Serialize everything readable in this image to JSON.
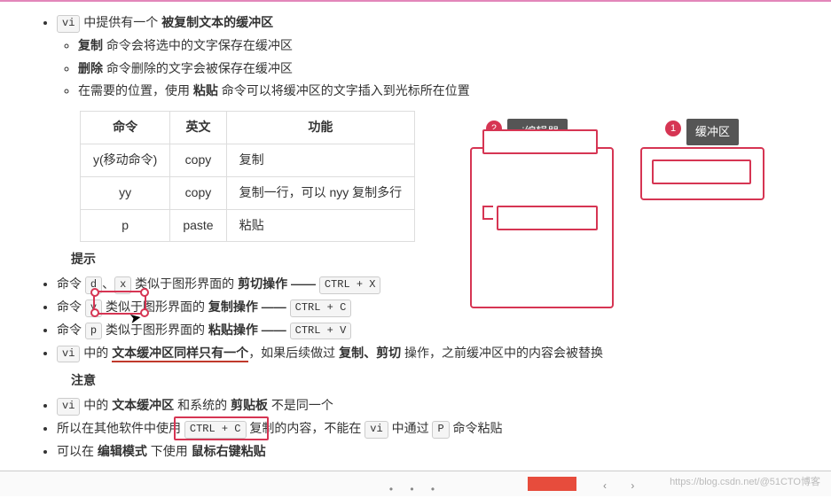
{
  "intro": {
    "vi_kbd": "vi",
    "intro_mid": " 中提供有一个 ",
    "intro_bold": "被复制文本的缓冲区"
  },
  "sub": {
    "copy_b": "复制",
    "copy_t": " 命令会将选中的文字保存在缓冲区",
    "del_b": "删除",
    "del_t": " 命令删除的文字会被保存在缓冲区",
    "paste_a": "在需要的位置，使用 ",
    "paste_b": "粘贴",
    "paste_c": " 命令可以将缓冲区的文字插入到光标所在位置"
  },
  "table": {
    "h1": "命令",
    "h2": "英文",
    "h3": "功能",
    "r1c1": "y(移动命令)",
    "r1c2": "copy",
    "r1c3": "复制",
    "r2c1": "yy",
    "r2c2": "copy",
    "r2c3": "复制一行，可以 nyy 复制多行",
    "r3c1": "p",
    "r3c2": "paste",
    "r3c3": "粘贴"
  },
  "tips_title": "提示",
  "tips": {
    "t1a": "命令 ",
    "t1_d": "d",
    "t1_sep": "、",
    "t1_x": "x",
    "t1b": " 类似于图形界面的 ",
    "t1op": "剪切操作 —— ",
    "t1k": "CTRL + X",
    "t2a": "命令 ",
    "t2_y": "y",
    "t2b": " 类似于图形界面的 ",
    "t2op": "复制操作 —— ",
    "t2k": "CTRL + C",
    "t3a": "命令 ",
    "t3_p": "p",
    "t3b": " 类似于图形界面的 ",
    "t3op": "粘贴操作 —— ",
    "t3k": "CTRL + V",
    "t4_vi": "vi",
    "t4a": " 中的 ",
    "t4b": "文本缓冲区同样只有一个",
    "t4c": "，如果后续做过 ",
    "t4d": "复制、剪切",
    "t4e": " 操作，之前缓冲区中的内容会被替换"
  },
  "note_title": "注意",
  "note": {
    "n1_vi": "vi",
    "n1a": " 中的 ",
    "n1b": "文本缓冲区",
    "n1c": " 和系统的 ",
    "n1d": "剪贴板",
    "n1e": " 不是同一个",
    "n2a": "所以在其他软件中使用 ",
    "n2k": "CTRL + C",
    "n2b": " 复制的内容，不能在 ",
    "n2_vi": "vi",
    "n2c": " 中通过 ",
    "n2_p": "P",
    "n2d": " 命令粘贴",
    "n3a": "可以在 ",
    "n3b": "编辑模式",
    "n3c": " 下使用 ",
    "n3d": "鼠标右键粘贴"
  },
  "diagram": {
    "vi_label": "vi编辑器",
    "buf_label": "缓冲区",
    "badge1": "1",
    "badge2": "2"
  },
  "watermark": "https://blog.csdn.net/@51CTO博客"
}
